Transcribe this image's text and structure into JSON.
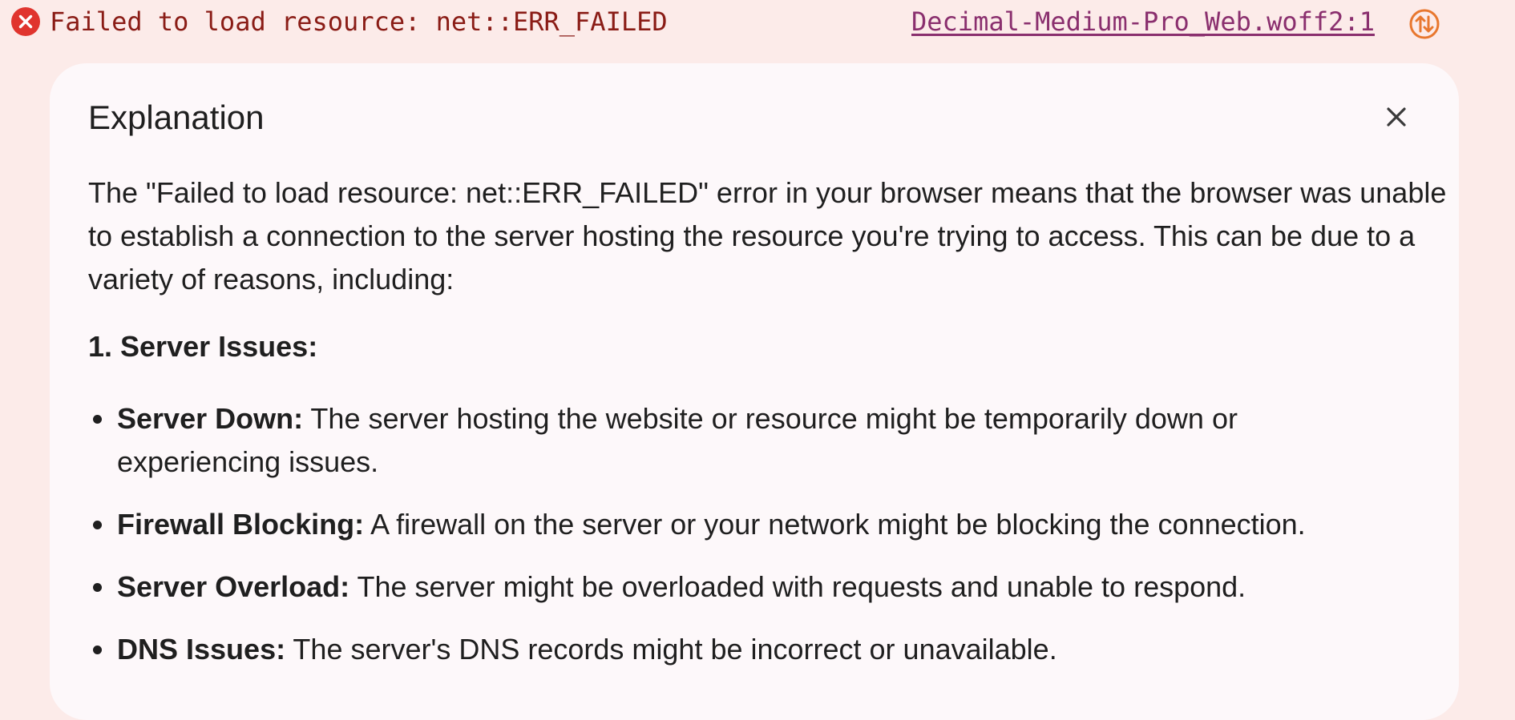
{
  "console_error": {
    "message": "Failed to load resource: net::ERR_FAILED",
    "source": "Decimal-Medium-Pro_Web.woff2:1",
    "icon": "error-circle-icon",
    "network_icon": "network-request-icon"
  },
  "explanation": {
    "title": "Explanation",
    "close_icon": "close-icon",
    "intro": "The \"Failed to load resource: net::ERR_FAILED\" error in your browser means that the browser was unable to establish a connection to the server hosting the resource you're trying to access. This can be due to a variety of reasons, including:",
    "section_heading": "1. Server Issues:",
    "items": [
      {
        "term": "Server Down:",
        "text": " The server hosting the website or resource might be temporarily down or experiencing issues."
      },
      {
        "term": "Firewall Blocking:",
        "text": " A firewall on the server or your network might be blocking the connection."
      },
      {
        "term": "Server Overload:",
        "text": " The server might be overloaded with requests and unable to respond."
      },
      {
        "term": "DNS Issues:",
        "text": " The server's DNS records might be incorrect or unavailable."
      }
    ]
  },
  "colors": {
    "page_background": "#fcebe9",
    "panel_background": "#fdf8fa",
    "error_red": "#e0342e",
    "error_text": "#8a1c16",
    "link": "#8a2f6e",
    "network_orange": "#e8772e"
  }
}
